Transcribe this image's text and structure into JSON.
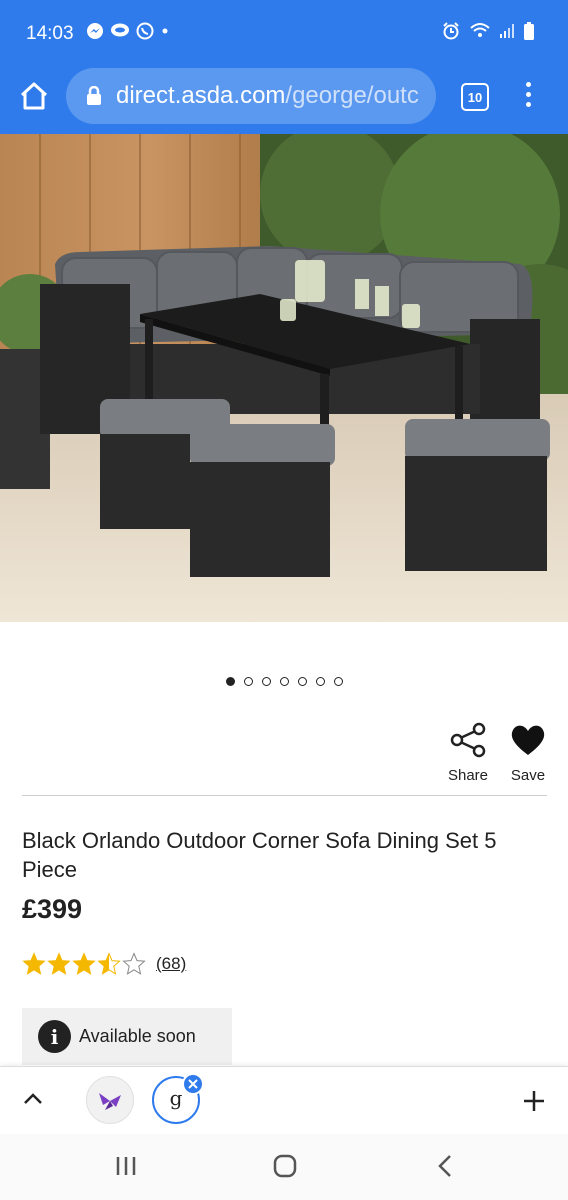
{
  "status_bar": {
    "time": "14:03",
    "icons": [
      "messenger-icon",
      "chat-icon",
      "whatsapp-icon",
      "dot-icon",
      "alarm-icon",
      "wifi-icon",
      "signal-icon",
      "battery-icon"
    ]
  },
  "browser": {
    "url_host": "direct.asda.com",
    "url_path": "/george/outc",
    "tab_count": "10",
    "accent_color": "#2f7bec"
  },
  "carousel": {
    "total": 7,
    "active_index": 0
  },
  "actions": {
    "share_label": "Share",
    "save_label": "Save"
  },
  "product": {
    "title": "Black Orlando Outdoor Corner Sofa Dining Set 5 Piece",
    "price": "£399",
    "rating": 3.5,
    "rating_max": 5,
    "review_count": "(68)",
    "star_color": "#f5b800",
    "availability": "Available soon"
  },
  "bottom_toolbar": {
    "tab_letter": "g"
  }
}
